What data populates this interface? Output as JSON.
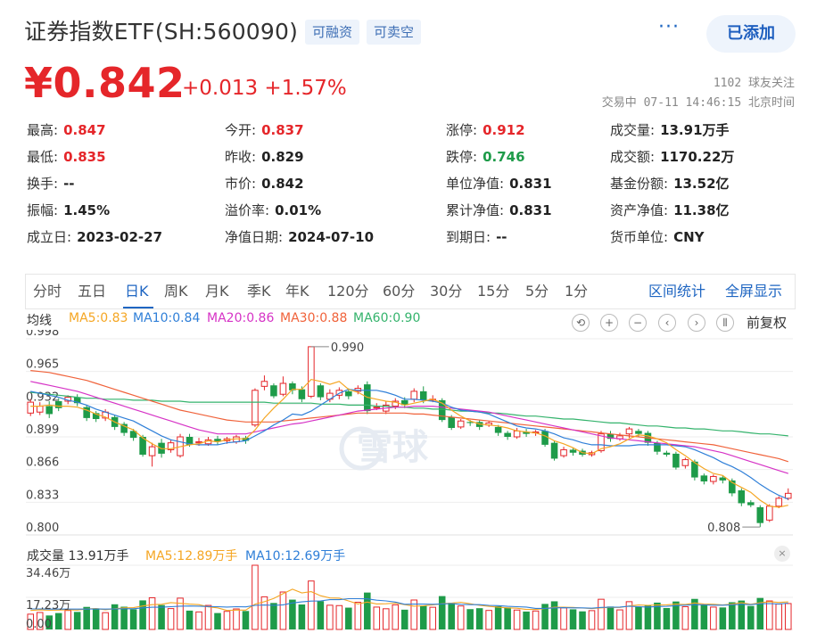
{
  "header": {
    "title": "证券指数ETF(SH:560090)",
    "tags": [
      "可融资",
      "可卖空"
    ],
    "more_label": "···",
    "add_button": "已添加",
    "price": "¥0.842",
    "change": "+0.013 +1.57%",
    "followers": "1102 球友关注",
    "trade_time": "交易中 07-11 14:46:15 北京时间"
  },
  "quote": {
    "col1": [
      {
        "label": "最高:",
        "value": "0.847",
        "color": "red"
      },
      {
        "label": "最低:",
        "value": "0.835",
        "color": "red"
      },
      {
        "label": "换手:",
        "value": "--",
        "color": ""
      },
      {
        "label": "振幅:",
        "value": "1.45%",
        "color": ""
      },
      {
        "label": "成立日:",
        "value": "2023-02-27",
        "color": ""
      }
    ],
    "col2": [
      {
        "label": "今开:",
        "value": "0.837",
        "color": "red"
      },
      {
        "label": "昨收:",
        "value": "0.829",
        "color": ""
      },
      {
        "label": "市价:",
        "value": "0.842",
        "color": ""
      },
      {
        "label": "溢价率:",
        "value": "0.01%",
        "color": ""
      },
      {
        "label": "净值日期:",
        "value": "2024-07-10",
        "color": ""
      }
    ],
    "col3": [
      {
        "label": "涨停:",
        "value": "0.912",
        "color": "red"
      },
      {
        "label": "跌停:",
        "value": "0.746",
        "color": "green"
      },
      {
        "label": "单位净值:",
        "value": "0.831",
        "color": ""
      },
      {
        "label": "累计净值:",
        "value": "0.831",
        "color": ""
      },
      {
        "label": "到期日:",
        "value": "--",
        "color": ""
      }
    ],
    "col4": [
      {
        "label": "成交量:",
        "value": "13.91万手",
        "color": ""
      },
      {
        "label": "成交额:",
        "value": "1170.22万",
        "color": ""
      },
      {
        "label": "基金份额:",
        "value": "13.52亿",
        "color": ""
      },
      {
        "label": "资产净值:",
        "value": "11.38亿",
        "color": ""
      },
      {
        "label": "货币单位:",
        "value": "CNY",
        "color": ""
      }
    ]
  },
  "tabs": {
    "items": [
      "分时",
      "五日",
      "日K",
      "周K",
      "月K",
      "季K",
      "年K",
      "120分",
      "60分",
      "30分",
      "15分",
      "5分",
      "1分"
    ],
    "active": "日K",
    "range_stats": "区间统计",
    "fullscreen": "全屏显示"
  },
  "ma_legend": {
    "avg_label": "均线",
    "items": [
      {
        "text": "MA5:0.83",
        "color": "#f5a623"
      },
      {
        "text": "MA10:0.84",
        "color": "#2f7fd8"
      },
      {
        "text": "MA20:0.86",
        "color": "#d633c6"
      },
      {
        "text": "MA30:0.88",
        "color": "#f0623a"
      },
      {
        "text": "MA60:0.90",
        "color": "#34b36c"
      }
    ],
    "fuquan": "前复权"
  },
  "controls": [
    "⟲",
    "+",
    "−",
    "‹",
    "›",
    "⫴"
  ],
  "volume_legend": {
    "label": "成交量 13.91万手",
    "ma5": "MA5:12.89万手",
    "ma10": "MA10:12.69万手",
    "close": "×"
  },
  "watermark": "雪球",
  "colors": {
    "up": "#e5262a",
    "down": "#1e9b49",
    "accent": "#1f66c2"
  },
  "chart_data": {
    "type": "candlestick",
    "yticks": [
      "0.998",
      "0.965",
      "0.932",
      "0.899",
      "0.866",
      "0.833",
      "0.800"
    ],
    "ylim": [
      0.8,
      0.998
    ],
    "annotations": {
      "high": "0.990",
      "low": "0.808"
    },
    "volume_yticks": [
      "34.46万",
      "17.23万",
      "0.00"
    ],
    "volume_ylim": [
      0,
      34.46
    ],
    "candles": [
      [
        0.923,
        0.934,
        0.937,
        0.92
      ],
      [
        0.924,
        0.93,
        0.934,
        0.921
      ],
      [
        0.93,
        0.922,
        0.935,
        0.918
      ],
      [
        0.935,
        0.928,
        0.938,
        0.925
      ],
      [
        0.935,
        0.939,
        0.941,
        0.932
      ],
      [
        0.939,
        0.933,
        0.942,
        0.93
      ],
      [
        0.929,
        0.918,
        0.931,
        0.915
      ],
      [
        0.923,
        0.917,
        0.925,
        0.914
      ],
      [
        0.918,
        0.924,
        0.927,
        0.915
      ],
      [
        0.919,
        0.909,
        0.921,
        0.906
      ],
      [
        0.912,
        0.903,
        0.914,
        0.9
      ],
      [
        0.905,
        0.898,
        0.907,
        0.895
      ],
      [
        0.899,
        0.881,
        0.901,
        0.879
      ],
      [
        0.88,
        0.889,
        0.893,
        0.869
      ],
      [
        0.893,
        0.882,
        0.897,
        0.878
      ],
      [
        0.886,
        0.893,
        0.896,
        0.883
      ],
      [
        0.88,
        0.899,
        0.902,
        0.878
      ],
      [
        0.899,
        0.891,
        0.902,
        0.889
      ],
      [
        0.893,
        0.894,
        0.898,
        0.89
      ],
      [
        0.892,
        0.896,
        0.899,
        0.89
      ],
      [
        0.897,
        0.894,
        0.9,
        0.891
      ],
      [
        0.895,
        0.897,
        0.899,
        0.892
      ],
      [
        0.894,
        0.899,
        0.901,
        0.892
      ],
      [
        0.898,
        0.895,
        0.9,
        0.892
      ],
      [
        0.911,
        0.946,
        0.948,
        0.909
      ],
      [
        0.95,
        0.955,
        0.961,
        0.946
      ],
      [
        0.951,
        0.94,
        0.953,
        0.938
      ],
      [
        0.942,
        0.953,
        0.96,
        0.94
      ],
      [
        0.953,
        0.946,
        0.955,
        0.942
      ],
      [
        0.947,
        0.937,
        0.95,
        0.934
      ],
      [
        0.94,
        0.99,
        0.99,
        0.938
      ],
      [
        0.951,
        0.939,
        0.953,
        0.936
      ],
      [
        0.937,
        0.943,
        0.947,
        0.934
      ],
      [
        0.941,
        0.946,
        0.949,
        0.937
      ],
      [
        0.945,
        0.94,
        0.948,
        0.937
      ],
      [
        0.945,
        0.948,
        0.951,
        0.942
      ],
      [
        0.952,
        0.925,
        0.955,
        0.922
      ],
      [
        0.929,
        0.929,
        0.933,
        0.926
      ],
      [
        0.925,
        0.931,
        0.935,
        0.922
      ],
      [
        0.93,
        0.935,
        0.938,
        0.927
      ],
      [
        0.936,
        0.931,
        0.939,
        0.928
      ],
      [
        0.937,
        0.945,
        0.948,
        0.934
      ],
      [
        0.945,
        0.936,
        0.95,
        0.933
      ],
      [
        0.937,
        0.937,
        0.941,
        0.934
      ],
      [
        0.936,
        0.916,
        0.938,
        0.914
      ],
      [
        0.919,
        0.908,
        0.921,
        0.906
      ],
      [
        0.909,
        0.915,
        0.917,
        0.907
      ],
      [
        0.914,
        0.913,
        0.916,
        0.91
      ],
      [
        0.914,
        0.909,
        0.916,
        0.906
      ],
      [
        0.911,
        0.913,
        0.915,
        0.909
      ],
      [
        0.909,
        0.903,
        0.911,
        0.9
      ],
      [
        0.903,
        0.899,
        0.905,
        0.896
      ],
      [
        0.899,
        0.905,
        0.908,
        0.897
      ],
      [
        0.904,
        0.902,
        0.907,
        0.899
      ],
      [
        0.903,
        0.904,
        0.906,
        0.9
      ],
      [
        0.905,
        0.891,
        0.907,
        0.889
      ],
      [
        0.893,
        0.877,
        0.895,
        0.875
      ],
      [
        0.88,
        0.886,
        0.889,
        0.878
      ],
      [
        0.886,
        0.883,
        0.888,
        0.88
      ],
      [
        0.885,
        0.881,
        0.887,
        0.879
      ],
      [
        0.881,
        0.883,
        0.885,
        0.879
      ],
      [
        0.885,
        0.902,
        0.905,
        0.883
      ],
      [
        0.902,
        0.897,
        0.905,
        0.894
      ],
      [
        0.897,
        0.9,
        0.903,
        0.895
      ],
      [
        0.902,
        0.907,
        0.909,
        0.898
      ],
      [
        0.905,
        0.902,
        0.907,
        0.899
      ],
      [
        0.903,
        0.893,
        0.905,
        0.89
      ],
      [
        0.893,
        0.884,
        0.895,
        0.881
      ],
      [
        0.883,
        0.881,
        0.885,
        0.879
      ],
      [
        0.882,
        0.868,
        0.884,
        0.866
      ],
      [
        0.87,
        0.876,
        0.878,
        0.867
      ],
      [
        0.874,
        0.858,
        0.876,
        0.855
      ],
      [
        0.86,
        0.854,
        0.862,
        0.851
      ],
      [
        0.854,
        0.859,
        0.861,
        0.851
      ],
      [
        0.858,
        0.855,
        0.86,
        0.852
      ],
      [
        0.855,
        0.842,
        0.857,
        0.839
      ],
      [
        0.845,
        0.832,
        0.847,
        0.829
      ],
      [
        0.833,
        0.83,
        0.835,
        0.828
      ],
      [
        0.828,
        0.812,
        0.83,
        0.808
      ],
      [
        0.815,
        0.829,
        0.831,
        0.813
      ],
      [
        0.829,
        0.837,
        0.839,
        0.827
      ],
      [
        0.837,
        0.842,
        0.847,
        0.835
      ]
    ],
    "ma5": [
      0.93,
      0.93,
      0.931,
      0.93,
      0.93,
      0.929,
      0.926,
      0.922,
      0.919,
      0.914,
      0.91,
      0.906,
      0.898,
      0.892,
      0.887,
      0.887,
      0.889,
      0.891,
      0.892,
      0.895,
      0.894,
      0.896,
      0.897,
      0.897,
      0.906,
      0.918,
      0.928,
      0.937,
      0.947,
      0.947,
      0.957,
      0.955,
      0.952,
      0.955,
      0.947,
      0.944,
      0.939,
      0.937,
      0.935,
      0.934,
      0.931,
      0.933,
      0.935,
      0.937,
      0.933,
      0.926,
      0.92,
      0.915,
      0.912,
      0.911,
      0.91,
      0.908,
      0.905,
      0.904,
      0.903,
      0.9,
      0.895,
      0.892,
      0.888,
      0.883,
      0.882,
      0.887,
      0.889,
      0.892,
      0.897,
      0.901,
      0.9,
      0.897,
      0.893,
      0.886,
      0.88,
      0.873,
      0.867,
      0.862,
      0.86,
      0.853,
      0.848,
      0.843,
      0.835,
      0.829,
      0.828,
      0.83
    ],
    "ma10": [
      0.945,
      0.943,
      0.941,
      0.939,
      0.936,
      0.934,
      0.931,
      0.927,
      0.924,
      0.921,
      0.918,
      0.915,
      0.91,
      0.905,
      0.9,
      0.896,
      0.894,
      0.892,
      0.891,
      0.891,
      0.891,
      0.893,
      0.894,
      0.895,
      0.9,
      0.905,
      0.911,
      0.916,
      0.922,
      0.921,
      0.925,
      0.931,
      0.937,
      0.943,
      0.947,
      0.946,
      0.946,
      0.946,
      0.944,
      0.941,
      0.937,
      0.937,
      0.936,
      0.935,
      0.933,
      0.929,
      0.926,
      0.925,
      0.924,
      0.922,
      0.918,
      0.914,
      0.91,
      0.908,
      0.907,
      0.905,
      0.902,
      0.898,
      0.896,
      0.893,
      0.891,
      0.891,
      0.89,
      0.89,
      0.89,
      0.891,
      0.891,
      0.891,
      0.891,
      0.89,
      0.889,
      0.886,
      0.882,
      0.878,
      0.873,
      0.869,
      0.864,
      0.858,
      0.851,
      0.845,
      0.84,
      0.836
    ],
    "ma20": [
      0.955,
      0.953,
      0.951,
      0.949,
      0.947,
      0.945,
      0.942,
      0.939,
      0.936,
      0.933,
      0.93,
      0.927,
      0.924,
      0.921,
      0.918,
      0.915,
      0.912,
      0.909,
      0.906,
      0.904,
      0.902,
      0.902,
      0.902,
      0.902,
      0.904,
      0.906,
      0.908,
      0.91,
      0.912,
      0.913,
      0.915,
      0.917,
      0.919,
      0.921,
      0.923,
      0.925,
      0.926,
      0.927,
      0.928,
      0.929,
      0.929,
      0.93,
      0.93,
      0.93,
      0.929,
      0.928,
      0.927,
      0.926,
      0.925,
      0.924,
      0.922,
      0.92,
      0.918,
      0.916,
      0.914,
      0.912,
      0.91,
      0.908,
      0.906,
      0.904,
      0.902,
      0.9,
      0.898,
      0.897,
      0.896,
      0.895,
      0.894,
      0.893,
      0.892,
      0.891,
      0.89,
      0.889,
      0.887,
      0.885,
      0.883,
      0.88,
      0.877,
      0.874,
      0.871,
      0.868,
      0.865,
      0.862
    ],
    "ma30": [
      0.966,
      0.965,
      0.964,
      0.962,
      0.96,
      0.958,
      0.956,
      0.953,
      0.95,
      0.947,
      0.944,
      0.941,
      0.938,
      0.935,
      0.932,
      0.929,
      0.926,
      0.924,
      0.922,
      0.92,
      0.918,
      0.916,
      0.915,
      0.914,
      0.914,
      0.914,
      0.914,
      0.915,
      0.916,
      0.917,
      0.918,
      0.919,
      0.92,
      0.921,
      0.922,
      0.923,
      0.923,
      0.923,
      0.923,
      0.923,
      0.923,
      0.922,
      0.922,
      0.921,
      0.92,
      0.919,
      0.918,
      0.917,
      0.916,
      0.915,
      0.914,
      0.913,
      0.912,
      0.911,
      0.91,
      0.909,
      0.908,
      0.907,
      0.906,
      0.905,
      0.904,
      0.903,
      0.902,
      0.901,
      0.9,
      0.899,
      0.898,
      0.897,
      0.896,
      0.895,
      0.894,
      0.893,
      0.892,
      0.891,
      0.889,
      0.887,
      0.885,
      0.883,
      0.881,
      0.879,
      0.877,
      0.874
    ],
    "ma60": [
      0.944,
      0.943,
      0.942,
      0.941,
      0.94,
      0.939,
      0.938,
      0.938,
      0.937,
      0.937,
      0.937,
      0.936,
      0.936,
      0.936,
      0.935,
      0.935,
      0.935,
      0.934,
      0.934,
      0.934,
      0.934,
      0.934,
      0.934,
      0.934,
      0.934,
      0.934,
      0.933,
      0.933,
      0.933,
      0.933,
      0.933,
      0.932,
      0.932,
      0.932,
      0.931,
      0.931,
      0.931,
      0.93,
      0.93,
      0.929,
      0.929,
      0.928,
      0.928,
      0.927,
      0.927,
      0.926,
      0.925,
      0.925,
      0.924,
      0.923,
      0.923,
      0.922,
      0.921,
      0.92,
      0.92,
      0.919,
      0.918,
      0.917,
      0.917,
      0.916,
      0.915,
      0.914,
      0.913,
      0.913,
      0.912,
      0.911,
      0.91,
      0.91,
      0.909,
      0.908,
      0.908,
      0.907,
      0.907,
      0.906,
      0.905,
      0.905,
      0.904,
      0.903,
      0.902,
      0.902,
      0.901,
      0.9
    ],
    "volume": [
      8.2,
      9.1,
      7.5,
      8.8,
      10.2,
      9.4,
      12.1,
      11.3,
      9.0,
      13.5,
      12.2,
      10.8,
      15.6,
      17.0,
      13.1,
      11.2,
      16.8,
      10.1,
      9.4,
      12.9,
      8.8,
      9.7,
      11.0,
      9.9,
      34.46,
      17.5,
      14.2,
      20.1,
      16.0,
      13.4,
      26.0,
      15.2,
      13.0,
      12.8,
      11.7,
      14.6,
      19.8,
      12.0,
      11.1,
      13.2,
      10.6,
      15.8,
      12.7,
      11.9,
      17.9,
      14.3,
      12.6,
      10.9,
      11.4,
      10.2,
      12.5,
      11.8,
      10.4,
      9.6,
      9.9,
      13.7,
      15.1,
      11.6,
      10.8,
      9.7,
      10.1,
      16.2,
      12.3,
      10.5,
      14.9,
      12.1,
      13.0,
      14.4,
      11.5,
      15.0,
      12.2,
      16.4,
      13.3,
      12.0,
      11.8,
      14.6,
      15.5,
      12.6,
      16.9,
      15.3,
      13.6,
      13.9
    ],
    "vol_ma5": [
      10.2,
      10.5,
      10.3,
      10.4,
      10.6,
      10.4,
      11.0,
      11.2,
      10.6,
      11.1,
      11.6,
      11.7,
      12.6,
      13.3,
      13.5,
      14.4,
      14.0,
      13.6,
      13.3,
      12.1,
      11.6,
      10.2,
      10.4,
      10.4,
      13.6,
      14.9,
      16.6,
      19.2,
      21.6,
      19.6,
      20.3,
      18.1,
      16.9,
      16.8,
      15.3,
      13.7,
      14.7,
      13.7,
      13.8,
      14.1,
      13.3,
      12.5,
      12.7,
      13.2,
      13.8,
      14.1,
      14.6,
      13.8,
      12.9,
      12.4,
      11.9,
      11.6,
      11.4,
      10.7,
      10.7,
      11.2,
      11.9,
      11.9,
      11.8,
      11.5,
      11.2,
      11.6,
      11.8,
      11.8,
      12.6,
      13.1,
      12.9,
      13.1,
      13.2,
      13.6,
      13.4,
      14.2,
      13.6,
      13.5,
      13.1,
      13.6,
      14.3,
      13.5,
      14.3,
      14.9,
      14.5,
      14.8
    ],
    "vol_ma10": [
      11.0,
      11.0,
      10.9,
      10.9,
      10.9,
      10.9,
      10.9,
      11.0,
      10.9,
      11.0,
      11.1,
      11.1,
      11.6,
      11.9,
      11.9,
      12.2,
      12.5,
      12.6,
      12.5,
      12.3,
      12.2,
      12.0,
      12.2,
      12.1,
      12.9,
      13.1,
      12.9,
      13.2,
      14.2,
      14.8,
      15.2,
      15.3,
      16.0,
      16.0,
      16.5,
      16.5,
      16.4,
      15.7,
      15.3,
      14.7,
      13.5,
      13.6,
      13.6,
      13.5,
      13.7,
      13.9,
      13.5,
      13.3,
      13.3,
      12.9,
      12.8,
      12.4,
      12.2,
      12.0,
      11.3,
      11.3,
      11.6,
      11.7,
      11.6,
      11.6,
      11.4,
      11.8,
      11.9,
      12.0,
      12.5,
      12.2,
      12.0,
      12.3,
      12.4,
      12.8,
      13.0,
      13.3,
      13.2,
      13.0,
      13.0,
      13.2,
      13.5,
      13.3,
      13.8,
      13.9,
      13.7,
      14.1
    ]
  }
}
